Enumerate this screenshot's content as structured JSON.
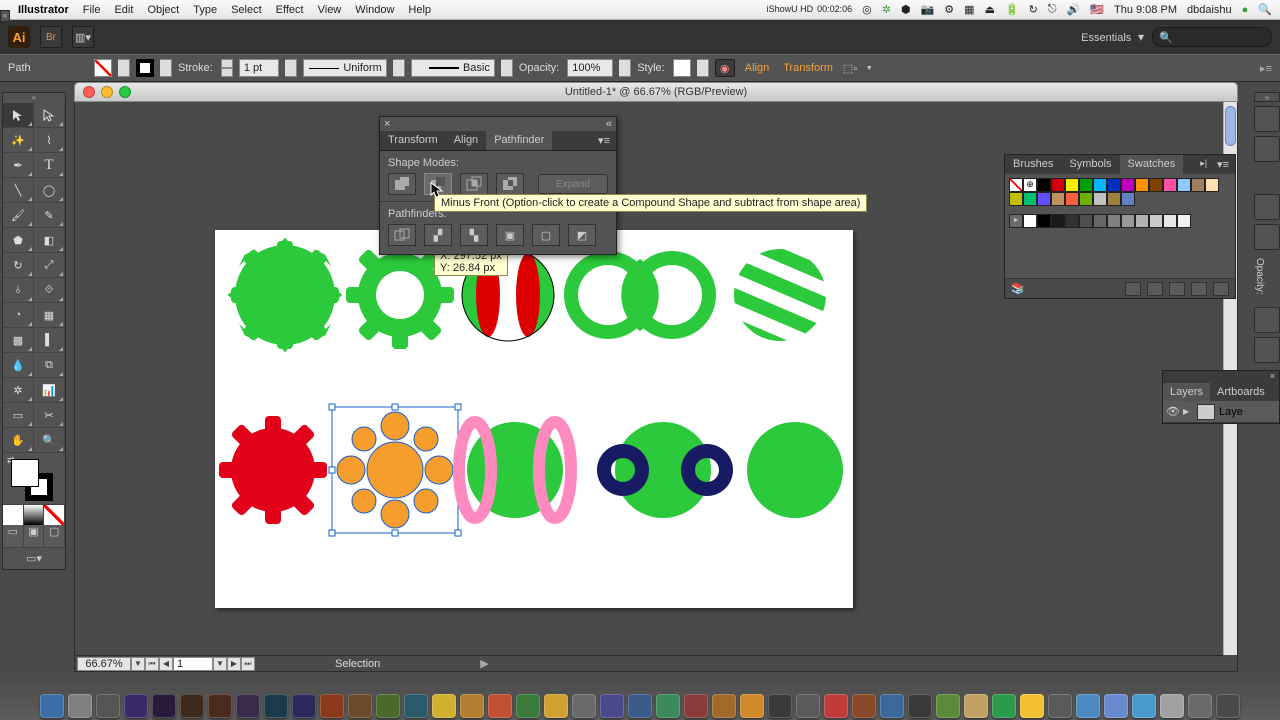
{
  "menubar": {
    "apple": "",
    "app": "Illustrator",
    "items": [
      "File",
      "Edit",
      "Object",
      "Type",
      "Select",
      "Effect",
      "View",
      "Window",
      "Help"
    ],
    "clock": "Thu 9:08 PM",
    "user": "dbdaishu",
    "rec": {
      "name": "iShowU HD",
      "time": "00:02:06"
    }
  },
  "appbar": {
    "workspace": "Essentials",
    "search_placeholder": ""
  },
  "controlbar": {
    "selection": "Path",
    "stroke_label": "Stroke:",
    "stroke_val": "1 pt",
    "profile": "Uniform",
    "brush": "Basic",
    "opacity_label": "Opacity:",
    "opacity_val": "100%",
    "style_label": "Style:",
    "align": "Align",
    "transform": "Transform"
  },
  "document": {
    "title": "Untitled-1* @ 66.67% (RGB/Preview)",
    "zoom": "66.67%",
    "page": "1",
    "status": "Selection"
  },
  "pathfinder": {
    "tabs": [
      "Transform",
      "Align",
      "Pathfinder"
    ],
    "active": 2,
    "section1": "Shape Modes:",
    "expand": "Expand",
    "section2": "Pathfinders:",
    "tooltip": "Minus Front (Option-click to create a Compound Shape and subtract from shape area)",
    "coord_x": "X: 297.52 px",
    "coord_y": "Y: 26.84 px"
  },
  "swatches": {
    "tabs": [
      "Brushes",
      "Symbols",
      "Swatches"
    ],
    "active": 2,
    "colors": [
      "#ffffff",
      "#ffffff",
      "#000000",
      "#d20000",
      "#ffee00",
      "#00a000",
      "#00b6ff",
      "#0030c0",
      "#c000c0",
      "#ff9000",
      "#804000",
      "#ff4fa0",
      "#8fc7ff",
      "#a08060",
      "#ffe0b0",
      "#c0c000",
      "#00c070",
      "#6050ff",
      "#c09060",
      "#ff6040",
      "#70b000",
      "#c0c0c0",
      "#a08040",
      "#6080c0"
    ],
    "grays": [
      "#ffffff",
      "#000000",
      "#1a1a1a",
      "#333333",
      "#4d4d4d",
      "#666666",
      "#808080",
      "#999999",
      "#b3b3b3",
      "#cccccc",
      "#e6e6e6",
      "#f2f2f2"
    ]
  },
  "layers": {
    "tabs": [
      "Layers",
      "Artboards"
    ],
    "active": 0,
    "items": [
      {
        "name": "Laye"
      }
    ]
  },
  "right_dock": [
    "",
    "",
    "",
    "Opacity:",
    ""
  ]
}
